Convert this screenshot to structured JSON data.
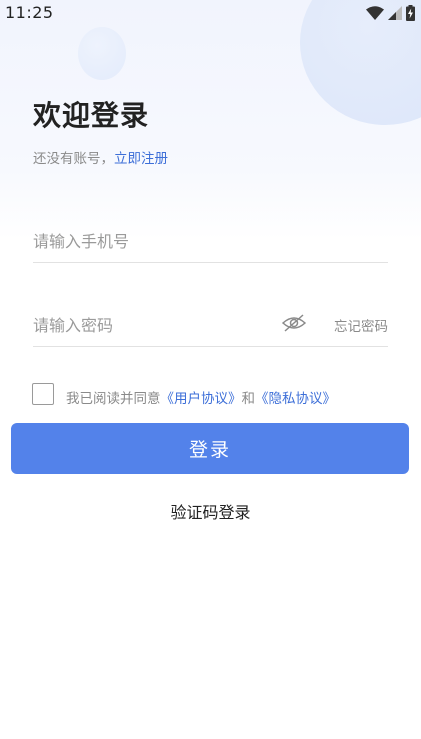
{
  "status_bar": {
    "time": "11:25"
  },
  "header": {
    "title": "欢迎登录",
    "no_account_text": "还没有账号，",
    "register_link": "立即注册"
  },
  "form": {
    "phone_placeholder": "请输入手机号",
    "password_placeholder": "请输入密码",
    "forgot_password": "忘记密码",
    "password_visibility_icon": "eye-off-icon"
  },
  "agreement": {
    "checked": false,
    "prefix": "我已阅读并同意",
    "user_agreement": "《用户协议》",
    "conjunction": "和",
    "privacy_policy": "《隐私协议》"
  },
  "actions": {
    "login_label": "登录",
    "sms_login_label": "验证码登录"
  },
  "colors": {
    "accent": "#5382ea",
    "link": "#3d6fd8"
  }
}
